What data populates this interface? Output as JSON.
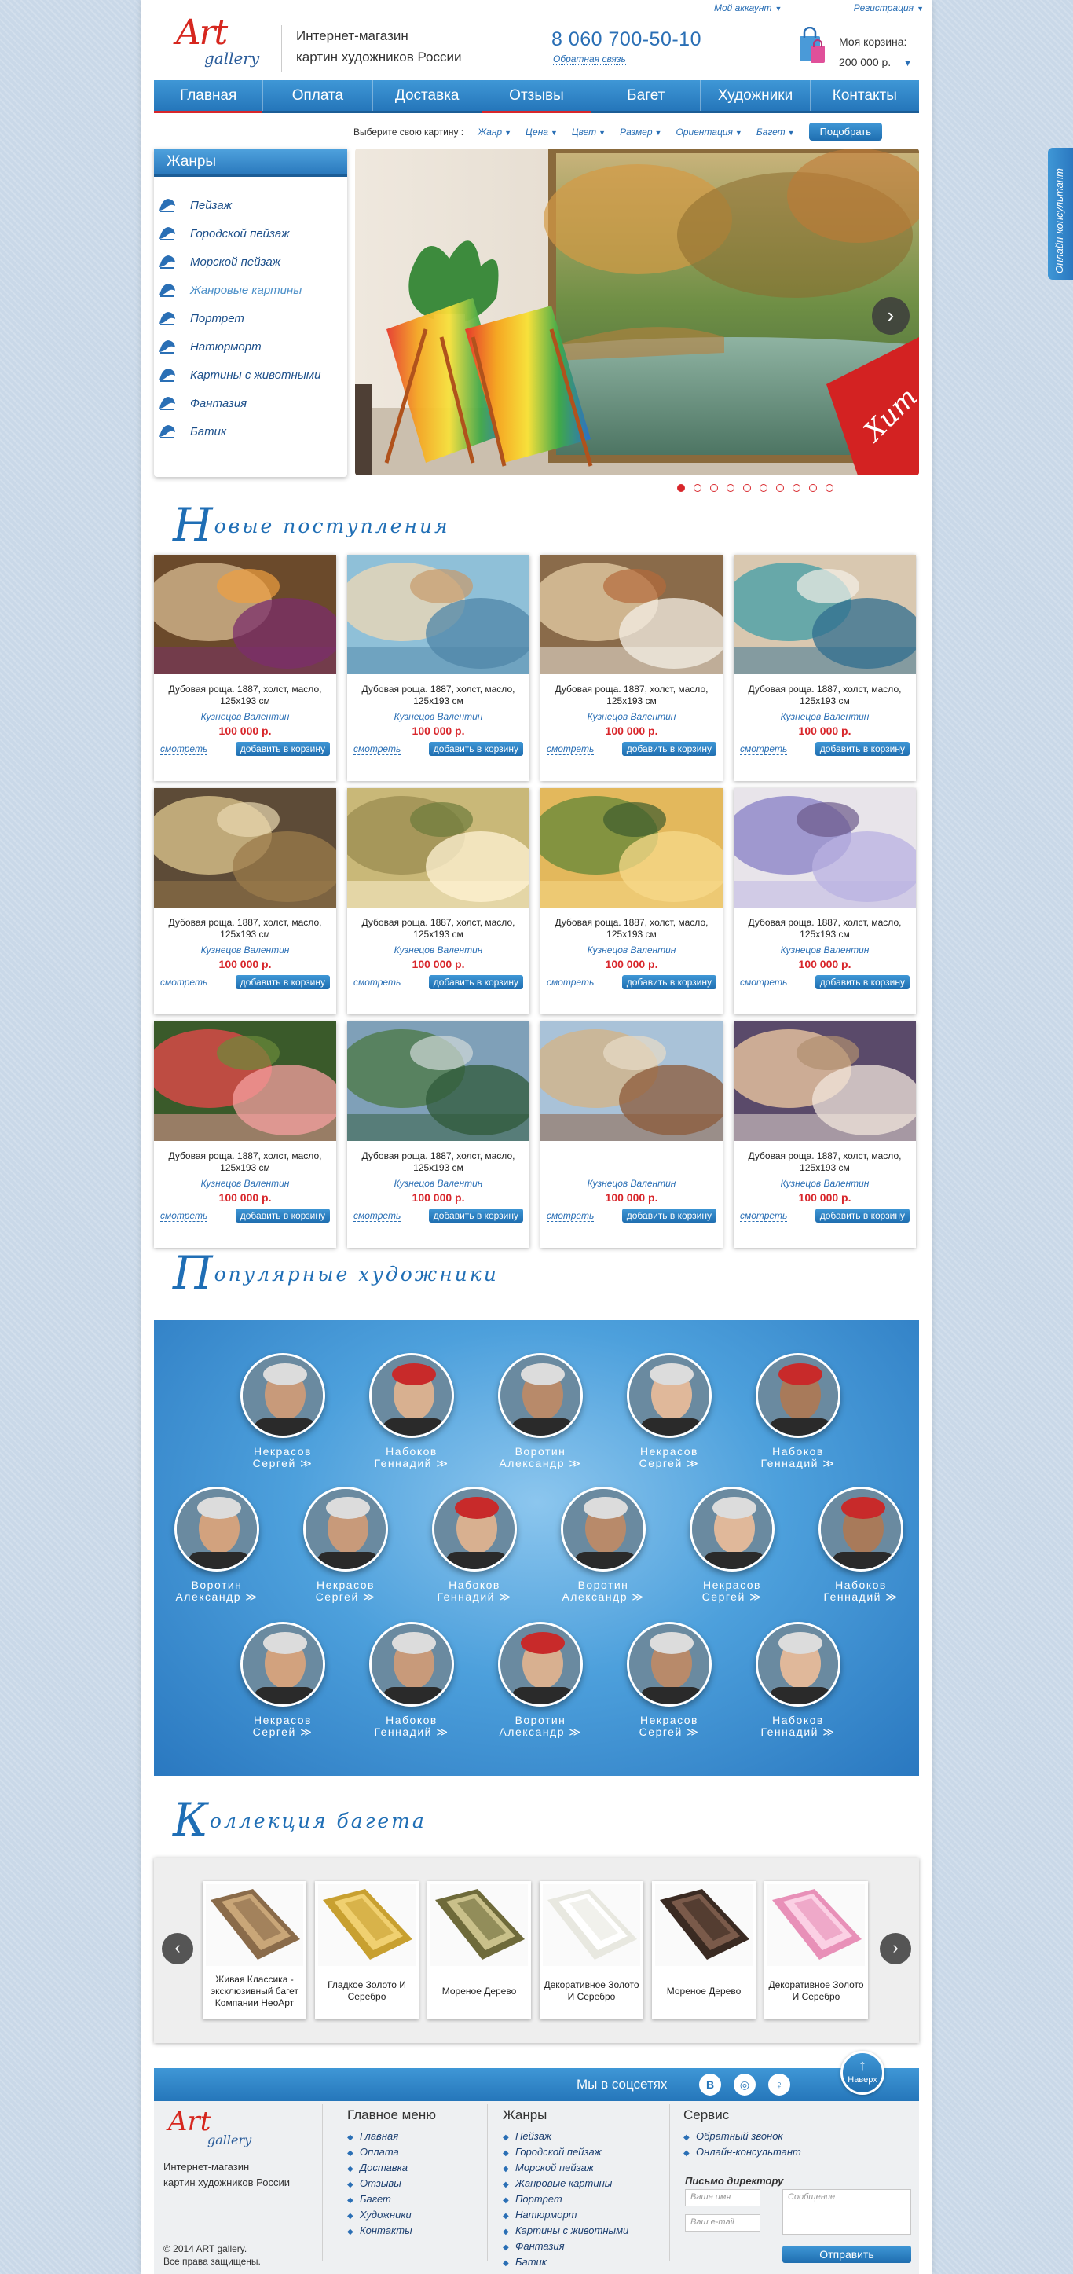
{
  "top": {
    "account": "Мой аккаунт",
    "register": "Регистрация"
  },
  "header": {
    "logo_art": "Art",
    "logo_gallery": "gallery",
    "tagline_1": "Интернет-магазин",
    "tagline_2": "картин художников России",
    "phone": "8 060 700-50-10",
    "callback": "Обратная связь",
    "cart_label": "Моя корзина:",
    "cart_total": "200 000 р."
  },
  "nav": [
    "Главная",
    "Оплата",
    "Доставка",
    "Отзывы",
    "Багет",
    "Художники",
    "Контакты"
  ],
  "filter": {
    "label": "Выберите свою картину :",
    "options": [
      "Жанр",
      "Цена",
      "Цвет",
      "Размер",
      "Ориентация",
      "Багет"
    ],
    "button": "Подобрать"
  },
  "genres": {
    "title": "Жанры",
    "items": [
      "Пейзаж",
      "Городской пейзаж",
      "Морской пейзаж",
      "Жанровые картины",
      "Портрет",
      "Натюрморт",
      "Картины с животными",
      "Фантазия",
      "Батик"
    ]
  },
  "slider": {
    "ribbon": "Хит",
    "dots": 10,
    "active": 0
  },
  "new_arrivals": {
    "title_cap": "Н",
    "title_rest": "овые поступления",
    "see": "смотреть",
    "add": "добавить в корзину",
    "products": [
      {
        "title": "Дубовая роща. 1887, холст, масло, 125x193 см",
        "author": "Кузнецов Валентин",
        "price": "100 000 р."
      },
      {
        "title": "Дубовая роща. 1887, холст, масло, 125x193 см",
        "author": "Кузнецов Валентин",
        "price": "100 000 р."
      },
      {
        "title": "Дубовая роща. 1887, холст, масло, 125x193 см",
        "author": "Кузнецов Валентин",
        "price": "100 000 р."
      },
      {
        "title": "Дубовая роща. 1887, холст, масло, 125x193 см",
        "author": "Кузнецов Валентин",
        "price": "100 000 р."
      },
      {
        "title": "Дубовая роща. 1887, холст, масло, 125x193 см",
        "author": "Кузнецов Валентин",
        "price": "100 000 р."
      },
      {
        "title": "Дубовая роща. 1887, холст, масло, 125x193 см",
        "author": "Кузнецов Валентин",
        "price": "100 000 р."
      },
      {
        "title": "Дубовая роща. 1887, холст, масло, 125x193 см",
        "author": "Кузнецов Валентин",
        "price": "100 000 р."
      },
      {
        "title": "Дубовая роща. 1887, холст, масло, 125x193 см",
        "author": "Кузнецов Валентин",
        "price": "100 000 р."
      },
      {
        "title": "Дубовая роща. 1887, холст, масло, 125x193 см",
        "author": "Кузнецов Валентин",
        "price": "100 000 р."
      },
      {
        "title": "Дубовая роща. 1887, холст, масло, 125x193 см",
        "author": "Кузнецов Валентин",
        "price": "100 000 р."
      },
      {
        "title": "",
        "author": "Кузнецов Валентин",
        "price": "100 000 р."
      },
      {
        "title": "Дубовая роща. 1887, холст, масло, 125x193 см",
        "author": "Кузнецов Валентин",
        "price": "100 000 р."
      }
    ]
  },
  "artists": {
    "title_cap": "П",
    "title_rest": "опулярные художники",
    "items": [
      {
        "first": "Некрасов",
        "last": "Сергей ≫"
      },
      {
        "first": "Набоков",
        "last": "Геннадий ≫"
      },
      {
        "first": "Воротин",
        "last": "Александр ≫"
      },
      {
        "first": "Некрасов",
        "last": "Сергей ≫"
      },
      {
        "first": "Набоков",
        "last": "Геннадий ≫"
      },
      {
        "first": "Воротин",
        "last": "Александр ≫"
      },
      {
        "first": "Некрасов",
        "last": "Сергей ≫"
      },
      {
        "first": "Набоков",
        "last": "Геннадий ≫"
      },
      {
        "first": "Воротин",
        "last": "Александр ≫"
      },
      {
        "first": "Некрасов",
        "last": "Сергей ≫"
      },
      {
        "first": "Набоков",
        "last": "Геннадий ≫"
      },
      {
        "first": "Некрасов",
        "last": "Сергей ≫"
      },
      {
        "first": "Набоков",
        "last": "Геннадий ≫"
      },
      {
        "first": "Воротин",
        "last": "Александр ≫"
      },
      {
        "first": "Некрасов",
        "last": "Сергей ≫"
      },
      {
        "first": "Набоков",
        "last": "Геннадий ≫"
      }
    ]
  },
  "baguette": {
    "title_cap": "К",
    "title_rest": "оллекция багета",
    "items": [
      "Живая Классика - эксклюзивный багет Компании НеоАрт",
      "Гладкое Золото И Серебро",
      "Мореное Дерево",
      "Декоративное Золото И Серебро",
      "Мореное Дерево",
      "Декоративное Золото И Серебро"
    ]
  },
  "social": {
    "label": "Мы в соцсетях",
    "up": "Наверх"
  },
  "footer": {
    "tagline_1": "Интернет-магазин",
    "tagline_2": "картин художников России",
    "copy_1": "© 2014 ART gallery.",
    "copy_2": "Все права защищены.",
    "menu_title": "Главное меню",
    "menu": [
      "Главная",
      "Оплата",
      "Доставка",
      "Отзывы",
      "Багет",
      "Художники",
      "Контакты"
    ],
    "genres_title": "Жанры",
    "genres": [
      "Пейзаж",
      "Городской пейзаж",
      "Морской пейзаж",
      "Жанровые картины",
      "Портрет",
      "Натюрморт",
      "Картины с животными",
      "Фантазия",
      "Батик"
    ],
    "service_title": "Сервис",
    "service": [
      "Обратный звонок",
      "Онлайн-консультант"
    ],
    "director_title": "Письмо директору",
    "name_ph": "Ваше имя",
    "email_ph": "Ваш e-mail",
    "message_ph": "Сообщение",
    "send": "Отправить"
  },
  "online": "Онлайн-консультант"
}
